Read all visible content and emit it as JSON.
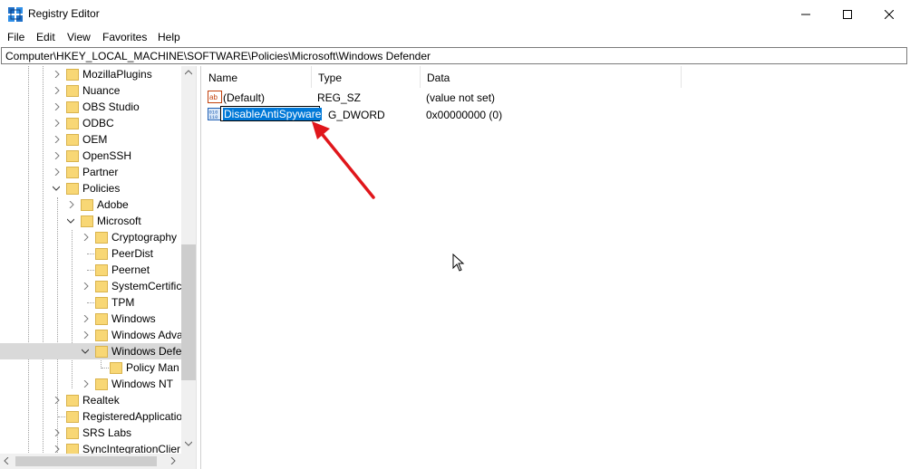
{
  "window": {
    "title": "Registry Editor"
  },
  "menu": [
    "File",
    "Edit",
    "View",
    "Favorites",
    "Help"
  ],
  "address": "Computer\\HKEY_LOCAL_MACHINE\\SOFTWARE\\Policies\\Microsoft\\Windows Defender",
  "tree": [
    {
      "label": "MozillaPlugins"
    },
    {
      "label": "Nuance"
    },
    {
      "label": "OBS Studio"
    },
    {
      "label": "ODBC"
    },
    {
      "label": "OEM"
    },
    {
      "label": "OpenSSH"
    },
    {
      "label": "Partner"
    },
    {
      "label": "Policies"
    },
    {
      "label": "Adobe"
    },
    {
      "label": "Microsoft"
    },
    {
      "label": "Cryptography"
    },
    {
      "label": "PeerDist"
    },
    {
      "label": "Peernet"
    },
    {
      "label": "SystemCertific"
    },
    {
      "label": "TPM"
    },
    {
      "label": "Windows"
    },
    {
      "label": "Windows Adva"
    },
    {
      "label": "Windows Defe"
    },
    {
      "label": "Policy Man"
    },
    {
      "label": "Windows NT"
    },
    {
      "label": "Realtek"
    },
    {
      "label": "RegisteredApplicatio"
    },
    {
      "label": "SRS Labs"
    },
    {
      "label": "SyncIntegrationClier"
    }
  ],
  "list": {
    "headers": [
      "Name",
      "Type",
      "Data"
    ],
    "rows": [
      {
        "name": "(Default)",
        "type": "REG_SZ",
        "data": "(value not set)",
        "icon": "string-value-icon"
      },
      {
        "name": "DisableAntiSpyware",
        "type": "G_DWORD",
        "data": "0x00000000 (0)",
        "icon": "dword-value-icon"
      }
    ]
  },
  "colors": {
    "selection": "#0078d7",
    "arrow": "#e0161b",
    "folder": "#f8d775"
  }
}
